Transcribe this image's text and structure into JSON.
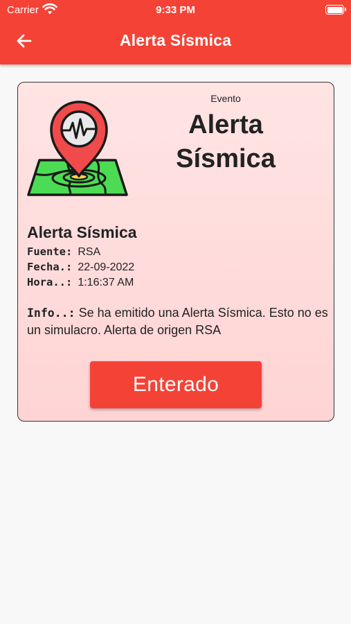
{
  "status_bar": {
    "carrier": "Carrier",
    "time": "9:33 PM",
    "wifi_icon": "wifi-icon",
    "battery_icon": "battery-icon"
  },
  "app_bar": {
    "back_icon": "arrow-left-icon",
    "title": "Alerta Sísmica",
    "color": "#f44336"
  },
  "card": {
    "event_label": "Evento",
    "event_title": "Alerta Sísmica",
    "logo_icon": "seismic-map-pin-icon",
    "heading": "Alerta Sísmica",
    "fields": [
      {
        "key": "Fuente:",
        "value": "RSA"
      },
      {
        "key": "Fecha.:",
        "value": "22-09-2022"
      },
      {
        "key": "Hora..:",
        "value": "1:16:37 AM"
      }
    ],
    "info_key": "Info..:",
    "info_value": "Se ha emitido una Alerta Sísmica. Esto no es un simulacro. Alerta de origen RSA",
    "button_label": "Enterado"
  }
}
